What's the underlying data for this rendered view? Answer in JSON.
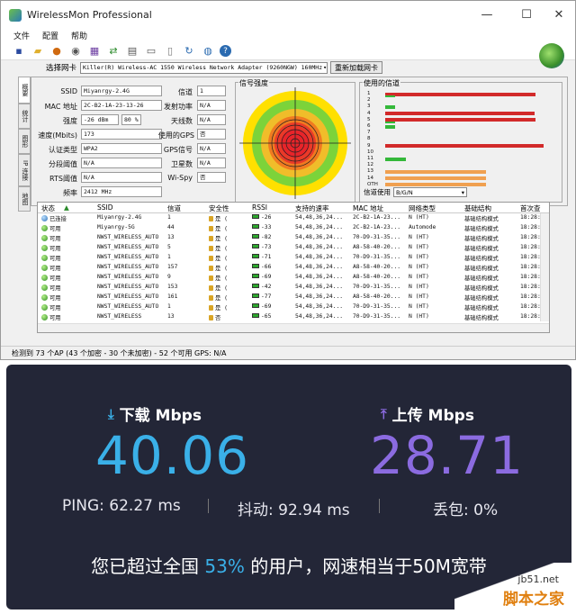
{
  "window": {
    "title": "WirelessMon Professional"
  },
  "menu": [
    "文件",
    "配置",
    "帮助"
  ],
  "adapter": {
    "label": "选择网卡",
    "value": "Killer(R) Wireless-AC 1550 Wireless Network Adapter (9260NGW) 160MHz",
    "reload": "重新加载网卡"
  },
  "tabs": [
    "概要",
    "统计",
    "图形",
    "IP 连接",
    "地图"
  ],
  "info": {
    "ssid_l": "SSID",
    "ssid": "Miyanrgy-2.4G",
    "mac_l": "MAC 地址",
    "mac": "2C-B2-1A-23-13-26",
    "strength_l": "强度",
    "strength": "-26 dBm",
    "strength_pct": "80 %",
    "speed_l": "速度(Mbits)",
    "speed": "173",
    "auth_l": "认证类型",
    "auth": "WPA2",
    "frag_l": "分段阈值",
    "frag": "N/A",
    "rts_l": "RTS阈值",
    "rts": "N/A",
    "freq_l": "频率",
    "freq": "2412 MHz",
    "channel_l": "信道",
    "channel": "1",
    "txpower_l": "发射功率",
    "txpower": "N/A",
    "antenna_l": "天线数",
    "antenna": "N/A",
    "usegps_l": "使用的GPS",
    "usegps": "否",
    "gpssig_l": "GPS信号",
    "gpssig": "N/A",
    "sat_l": "卫星数",
    "sat": "N/A",
    "wispy_l": "Wi-Spy",
    "wispy": "否"
  },
  "signal": {
    "caption": "信号强度"
  },
  "channels": {
    "caption": "使用的信道",
    "rows": [
      {
        "label": "1",
        "red": 0.93,
        "green": 0.06
      },
      {
        "label": "2",
        "red": 0,
        "green": 0
      },
      {
        "label": "3",
        "red": 0,
        "green": 0.06
      },
      {
        "label": "4",
        "red": 0.92,
        "green": 0
      },
      {
        "label": "5",
        "red": 0.93,
        "green": 0.06
      },
      {
        "label": "6",
        "red": 0,
        "green": 0.06
      },
      {
        "label": "7",
        "red": 0,
        "green": 0
      },
      {
        "label": "8",
        "red": 0,
        "green": 0
      },
      {
        "label": "9",
        "red": 0.98,
        "green": 0
      },
      {
        "label": "10",
        "red": 0,
        "green": 0
      },
      {
        "label": "11",
        "red": 0,
        "green": 0.13
      },
      {
        "label": "12",
        "red": 0,
        "green": 0
      },
      {
        "label": "13",
        "orange": 0.62
      },
      {
        "label": "14",
        "orange": 0.62
      },
      {
        "label": "OTH",
        "orange": 0.62
      }
    ],
    "use_label": "信道使用",
    "use_value": "B/G/N"
  },
  "table": {
    "headers": [
      "状态",
      "SSID",
      "信道",
      "安全性",
      "RSSI",
      "支持的速率",
      "MAC 地址",
      "网络类型",
      "基础结构",
      "首次查"
    ],
    "rows": [
      [
        "已连接",
        "Miyanrgy-2.4G",
        "1",
        "是 (",
        "-26",
        "54,48,36,24...",
        "2C-B2-1A-23...",
        "N (HT)",
        "基础结构模式",
        "18:28:"
      ],
      [
        "可用",
        "Miyanrgy-5G",
        "44",
        "是 (",
        "-33",
        "54,48,36,24...",
        "2C-B2-1A-23...",
        "Automode",
        "基础结构模式",
        "18:28:"
      ],
      [
        "可用",
        "NWST_WIRELESS_AUTO",
        "13",
        "是 (",
        "-82",
        "54,48,36,24...",
        "70-D9-31-35...",
        "N (HT)",
        "基础结构模式",
        "18:28:"
      ],
      [
        "可用",
        "NWST_WIRELESS_AUTO",
        "5",
        "是 (",
        "-73",
        "54,48,36,24...",
        "A8-58-40-20...",
        "N (HT)",
        "基础结构模式",
        "18:28:"
      ],
      [
        "可用",
        "NWST_WIRELESS_AUTO",
        "1",
        "是 (",
        "-71",
        "54,48,36,24...",
        "70-D9-31-35...",
        "N (HT)",
        "基础结构模式",
        "18:28:"
      ],
      [
        "可用",
        "NWST_WIRELESS_AUTO",
        "157",
        "是 (",
        "-66",
        "54,48,36,24...",
        "A8-58-40-20...",
        "N (HT)",
        "基础结构模式",
        "18:28:"
      ],
      [
        "可用",
        "NWST_WIRELESS_AUTO",
        "9",
        "是 (",
        "-69",
        "54,48,36,24...",
        "A8-58-40-20...",
        "N (HT)",
        "基础结构模式",
        "18:28:"
      ],
      [
        "可用",
        "NWST_WIRELESS_AUTO",
        "153",
        "是 (",
        "-42",
        "54,48,36,24...",
        "70-D9-31-35...",
        "N (HT)",
        "基础结构模式",
        "18:28:"
      ],
      [
        "可用",
        "NWST_WIRELESS_AUTO",
        "161",
        "是 (",
        "-77",
        "54,48,36,24...",
        "A8-58-40-20...",
        "N (HT)",
        "基础结构模式",
        "18:28:"
      ],
      [
        "可用",
        "NWST_WIRELESS_AUTO",
        "1",
        "是 (",
        "-69",
        "54,48,36,24...",
        "70-D9-31-35...",
        "N (HT)",
        "基础结构模式",
        "18:28:"
      ],
      [
        "可用",
        "NWST_WIRELESS",
        "13",
        "否",
        "-65",
        "54,48,36,24...",
        "70-D9-31-35...",
        "N (HT)",
        "基础结构模式",
        "18:28:"
      ]
    ]
  },
  "status": "检测到 73 个AP (43 个加密 - 30 个未加密) - 52 个可用   GPS: N/A",
  "speedtest": {
    "down_label": "下载 Mbps",
    "down_value": "40.06",
    "down_color": "#3ab0e8",
    "up_label": "上传 Mbps",
    "up_value": "28.71",
    "up_color": "#8b6be0",
    "ping": "PING: 62.27 ms",
    "jitter": "抖动: 92.94 ms",
    "loss": "丢包: 0%",
    "footer_pre": "您已超过全国 ",
    "footer_pct": "53%",
    "footer_post": " 的用户，网速相当于50M宽带"
  },
  "watermark": {
    "line1": "jb51.net",
    "line2": "脚本之家"
  }
}
